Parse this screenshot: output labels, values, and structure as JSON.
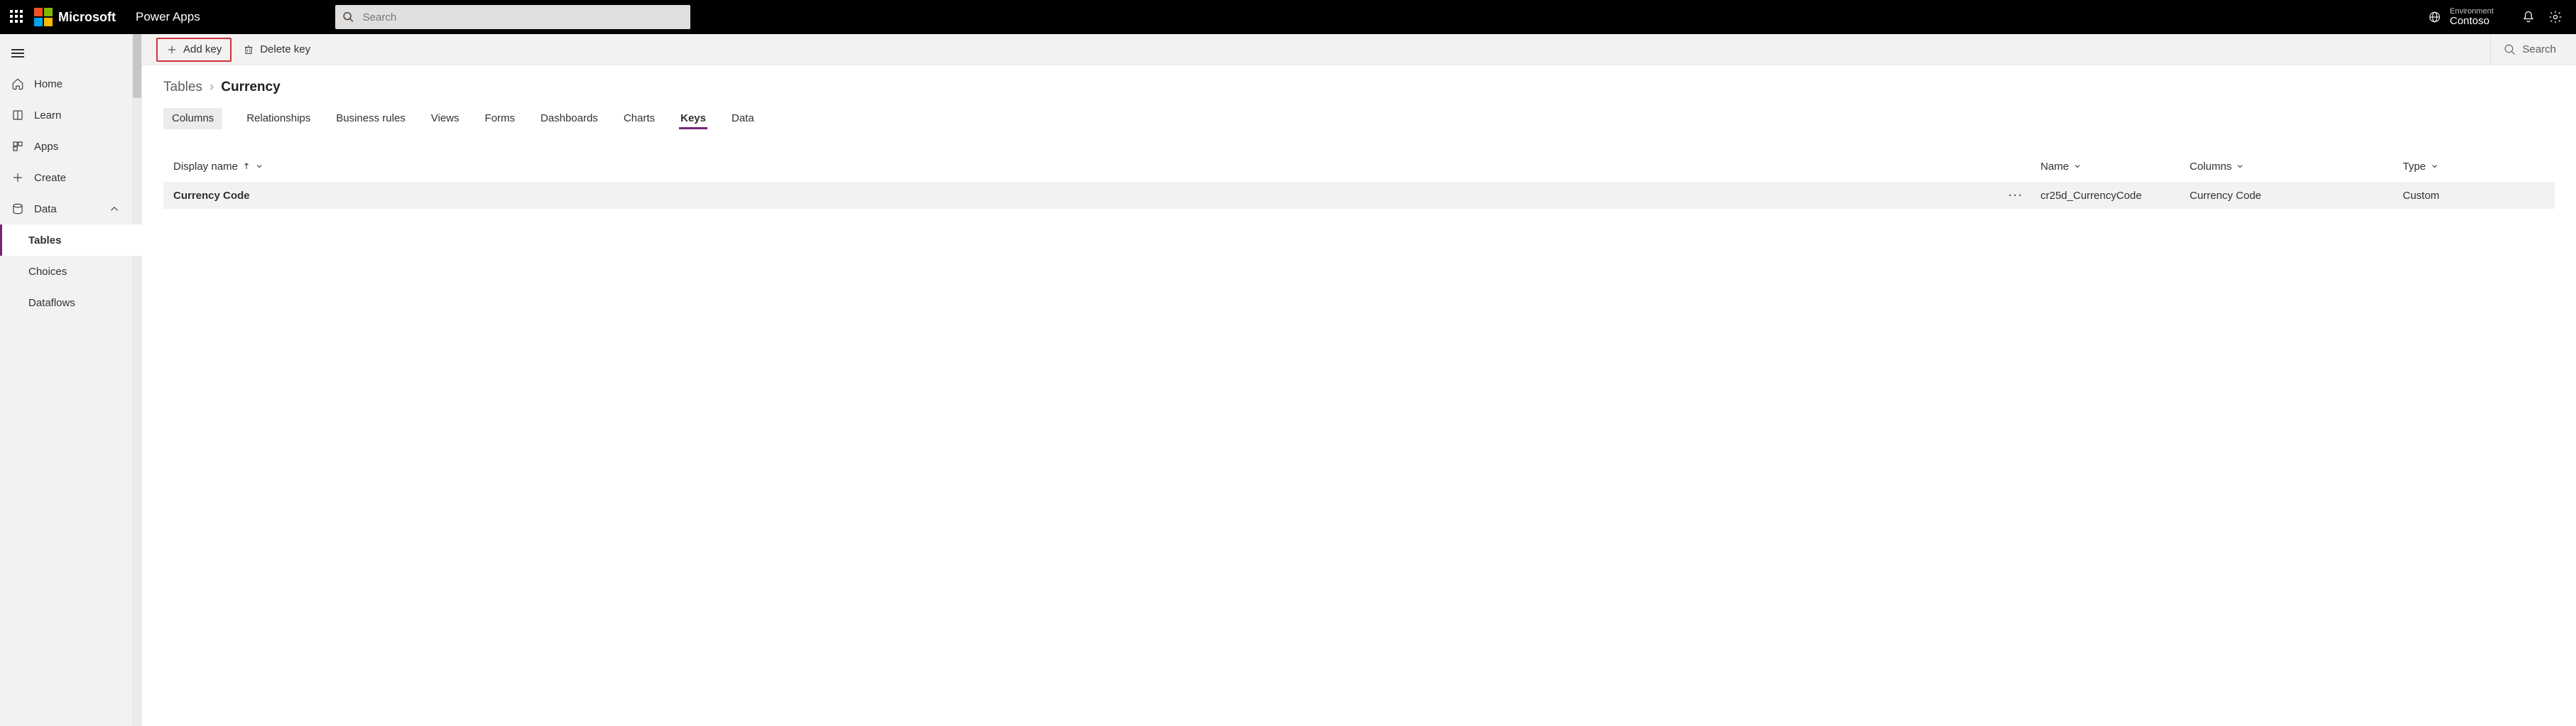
{
  "header": {
    "brand": "Microsoft",
    "app_name": "Power Apps",
    "search_placeholder": "Search",
    "env_label": "Environment",
    "env_name": "Contoso"
  },
  "nav": {
    "items": [
      {
        "label": "Home"
      },
      {
        "label": "Learn"
      },
      {
        "label": "Apps"
      },
      {
        "label": "Create"
      },
      {
        "label": "Data"
      }
    ],
    "data_children": [
      {
        "label": "Tables"
      },
      {
        "label": "Choices"
      },
      {
        "label": "Dataflows"
      }
    ]
  },
  "cmdbar": {
    "add_key": "Add key",
    "delete_key": "Delete key",
    "search": "Search"
  },
  "breadcrumb": {
    "parent": "Tables",
    "current": "Currency"
  },
  "tabs": [
    "Columns",
    "Relationships",
    "Business rules",
    "Views",
    "Forms",
    "Dashboards",
    "Charts",
    "Keys",
    "Data"
  ],
  "active_tab": "Keys",
  "columns": {
    "display_name": "Display name",
    "name": "Name",
    "columns": "Columns",
    "type": "Type"
  },
  "rows": [
    {
      "display_name": "Currency Code",
      "name": "cr25d_CurrencyCode",
      "columns": "Currency Code",
      "type": "Custom"
    }
  ]
}
